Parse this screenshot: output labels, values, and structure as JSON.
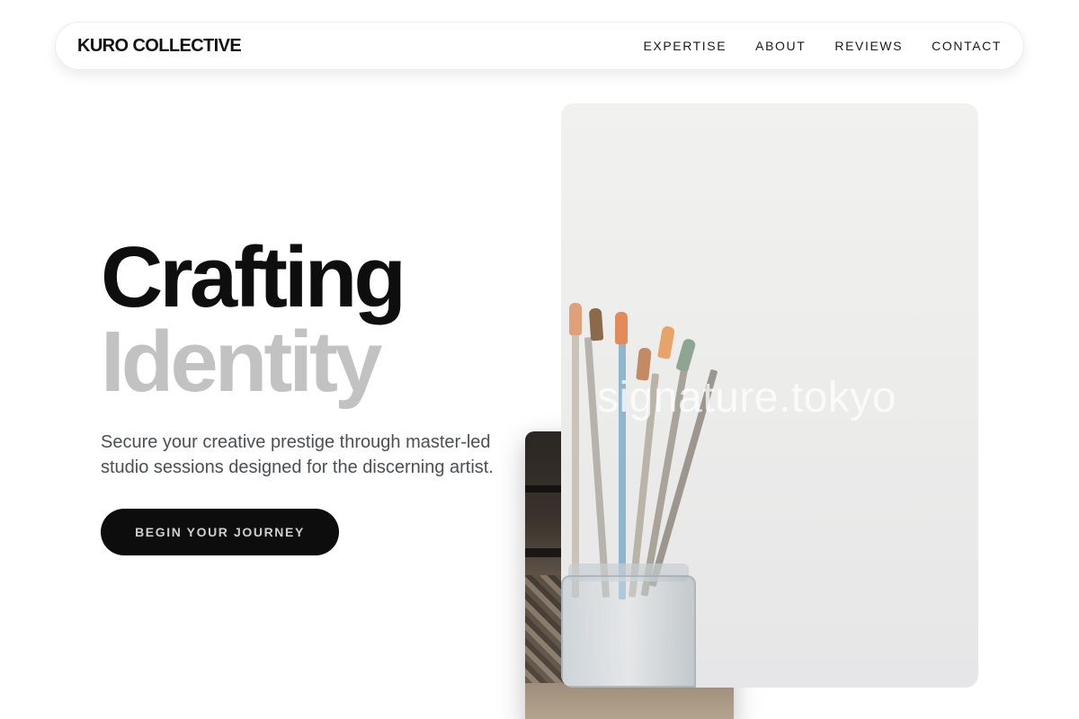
{
  "brand": "KURO COLLECTIVE",
  "nav": [
    "EXPERTISE",
    "ABOUT",
    "REVIEWS",
    "CONTACT"
  ],
  "hero": {
    "title_line1": "Crafting",
    "title_line2": "Identity",
    "subtitle": "Secure your creative prestige through master-led studio sessions designed for the discerning artist.",
    "cta": "BEGIN YOUR JOURNEY"
  },
  "image": {
    "watermark": "signature.tokyo"
  },
  "colors": {
    "text_dark": "#0e0e0e",
    "text_muted": "#c2c2c2",
    "button_bg": "#0d0d0d",
    "button_text": "#cfcfcf",
    "subtitle": "#4b4f55"
  }
}
